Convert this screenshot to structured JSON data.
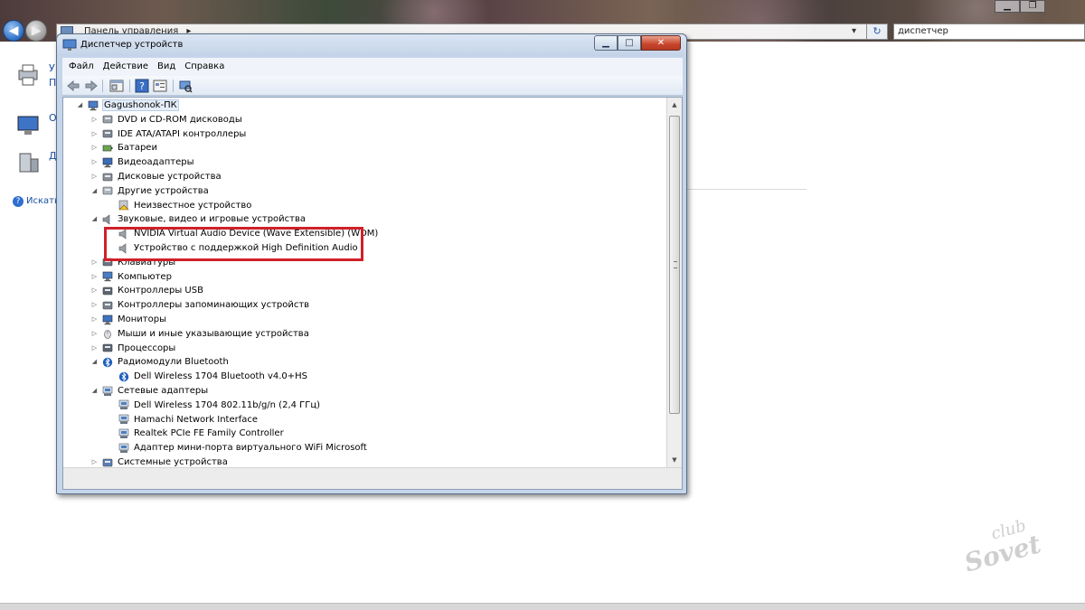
{
  "explorer": {
    "breadcrumb": "Панель управления",
    "search_value": "диспетчер",
    "help_label": "Искать",
    "side_letters": [
      "У",
      "П",
      "О",
      "Д"
    ]
  },
  "device_manager": {
    "title": "Диспетчер устройств",
    "window_buttons": {
      "minimize": "▁",
      "maximize": "□",
      "close": "✕"
    },
    "menu": [
      "Файл",
      "Действие",
      "Вид",
      "Справка"
    ],
    "toolbar": [
      "back-icon",
      "forward-icon",
      "show-hide-tree-icon",
      "help-icon",
      "properties-icon",
      "scan-hardware-icon"
    ],
    "tree": [
      {
        "label": "Gagushonok-ПК",
        "icon": "computer-icon",
        "expander": "◢",
        "level": 0
      },
      {
        "label": "DVD и CD-ROM дисководы",
        "icon": "dvd-drive-icon",
        "expander": "▷",
        "level": 1
      },
      {
        "label": "IDE ATA/ATAPI контроллеры",
        "icon": "ide-controller-icon",
        "expander": "▷",
        "level": 1
      },
      {
        "label": "Батареи",
        "icon": "battery-icon",
        "expander": "▷",
        "level": 1
      },
      {
        "label": "Видеоадаптеры",
        "icon": "display-adapter-icon",
        "expander": "▷",
        "level": 1
      },
      {
        "label": "Дисковые устройства",
        "icon": "disk-drive-icon",
        "expander": "▷",
        "level": 1
      },
      {
        "label": "Другие устройства",
        "icon": "other-devices-icon",
        "expander": "◢",
        "level": 1
      },
      {
        "label": "Неизвестное устройство",
        "icon": "unknown-device-icon",
        "expander": "",
        "level": 2
      },
      {
        "label": "Звуковые, видео и игровые устройства",
        "icon": "sound-device-icon",
        "expander": "◢",
        "level": 1
      },
      {
        "label": "NVIDIA Virtual Audio Device (Wave Extensible) (WDM)",
        "icon": "speaker-icon",
        "expander": "",
        "level": 2
      },
      {
        "label": "Устройство с поддержкой High Definition Audio",
        "icon": "speaker-icon",
        "expander": "",
        "level": 2
      },
      {
        "label": "Клавиатуры",
        "icon": "keyboard-icon",
        "expander": "▷",
        "level": 1
      },
      {
        "label": "Компьютер",
        "icon": "computer-icon",
        "expander": "▷",
        "level": 1
      },
      {
        "label": "Контроллеры USB",
        "icon": "usb-icon",
        "expander": "▷",
        "level": 1
      },
      {
        "label": "Контроллеры запоминающих устройств",
        "icon": "storage-controller-icon",
        "expander": "▷",
        "level": 1
      },
      {
        "label": "Мониторы",
        "icon": "monitor-icon",
        "expander": "▷",
        "level": 1
      },
      {
        "label": "Мыши и иные указывающие устройства",
        "icon": "mouse-icon",
        "expander": "▷",
        "level": 1
      },
      {
        "label": "Процессоры",
        "icon": "processor-icon",
        "expander": "▷",
        "level": 1
      },
      {
        "label": "Радиомодули Bluetooth",
        "icon": "bluetooth-icon",
        "expander": "◢",
        "level": 1
      },
      {
        "label": "Dell Wireless 1704 Bluetooth v4.0+HS",
        "icon": "bluetooth-icon",
        "expander": "",
        "level": 2
      },
      {
        "label": "Сетевые адаптеры",
        "icon": "network-adapter-icon",
        "expander": "◢",
        "level": 1
      },
      {
        "label": "Dell Wireless 1704 802.11b/g/n (2,4 ГГц)",
        "icon": "network-adapter-icon",
        "expander": "",
        "level": 2
      },
      {
        "label": "Hamachi Network Interface",
        "icon": "network-adapter-icon",
        "expander": "",
        "level": 2
      },
      {
        "label": "Realtek PCIe FE Family Controller",
        "icon": "network-adapter-icon",
        "expander": "",
        "level": 2
      },
      {
        "label": "Адаптер мини-порта виртуального WiFi Microsoft",
        "icon": "network-adapter-icon",
        "expander": "",
        "level": 2
      },
      {
        "label": "Системные устройства",
        "icon": "system-devices-icon",
        "expander": "▷",
        "level": 1
      }
    ]
  },
  "watermark": {
    "line1": "club",
    "line2": "Sovet"
  },
  "colors": {
    "highlight": "#d0202a",
    "link": "#1a4fa0",
    "window_frame": "#c5d5ea"
  }
}
